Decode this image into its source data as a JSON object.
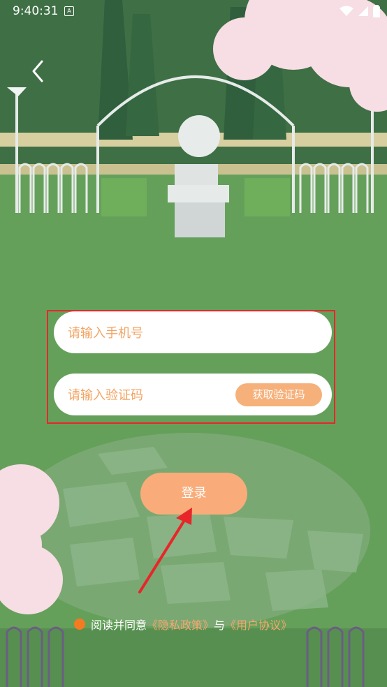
{
  "status_bar": {
    "time": "9:40:31",
    "notification_glyph": "A"
  },
  "login_form": {
    "phone_placeholder": "请输入手机号",
    "code_placeholder": "请输入验证码",
    "get_code_label": "获取验证码"
  },
  "login_button_label": "登录",
  "agreement": {
    "prefix": "阅读并同意",
    "privacy_link": "《隐私政策》",
    "connector": "与",
    "terms_link": "《用户协议》"
  },
  "colors": {
    "accent": "#f9ac79",
    "placeholder": "#f2a463",
    "radio": "#f47b20",
    "annotation": "#e8262a"
  },
  "icons": {
    "back": "chevron-left-icon",
    "wifi": "wifi-icon",
    "signal": "signal-icon",
    "battery": "battery-icon"
  }
}
